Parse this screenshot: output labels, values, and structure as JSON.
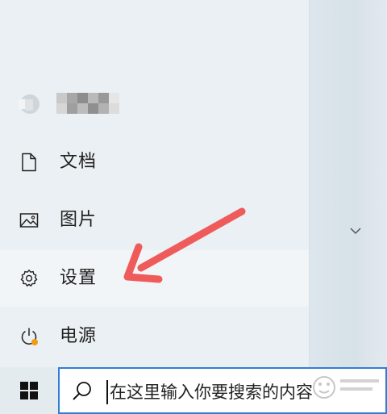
{
  "menu": {
    "items": [
      {
        "label": "文档",
        "icon": "document-icon"
      },
      {
        "label": "图片",
        "icon": "pictures-icon"
      },
      {
        "label": "设置",
        "icon": "gear-icon"
      },
      {
        "label": "电源",
        "icon": "power-icon"
      }
    ]
  },
  "search": {
    "placeholder": "在这里输入你要搜索的内容"
  },
  "colors": {
    "search_border": "#2f7fd5",
    "annotation_arrow": "#ef5b5b",
    "power_badge": "#f39c12"
  }
}
